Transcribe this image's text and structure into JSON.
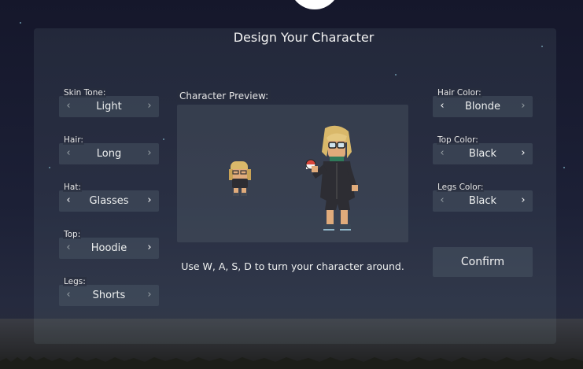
{
  "title": "Design Your Character",
  "left_options": [
    {
      "label": "Skin Tone:",
      "value": "Light"
    },
    {
      "label": "Hair:",
      "value": "Long"
    },
    {
      "label": "Hat:",
      "value": "Glasses"
    },
    {
      "label": "Top:",
      "value": "Hoodie"
    },
    {
      "label": "Legs:",
      "value": "Shorts"
    }
  ],
  "right_options": [
    {
      "label": "Hair Color:",
      "value": "Blonde"
    },
    {
      "label": "Top Color:",
      "value": "Black"
    },
    {
      "label": "Legs Color:",
      "value": "Black"
    }
  ],
  "preview": {
    "label": "Character Preview:",
    "hint": "Use W, A, S, D to turn your character around."
  },
  "confirm_label": "Confirm",
  "icons": {
    "prev": "chevron-left-icon",
    "next": "chevron-right-icon",
    "moon": "crescent-moon-icon"
  },
  "colors": {
    "hair": "#d9b86a",
    "skin": "#e0ab7b",
    "top": "#2d2d33",
    "accent_collar": "#2f7a5a"
  }
}
